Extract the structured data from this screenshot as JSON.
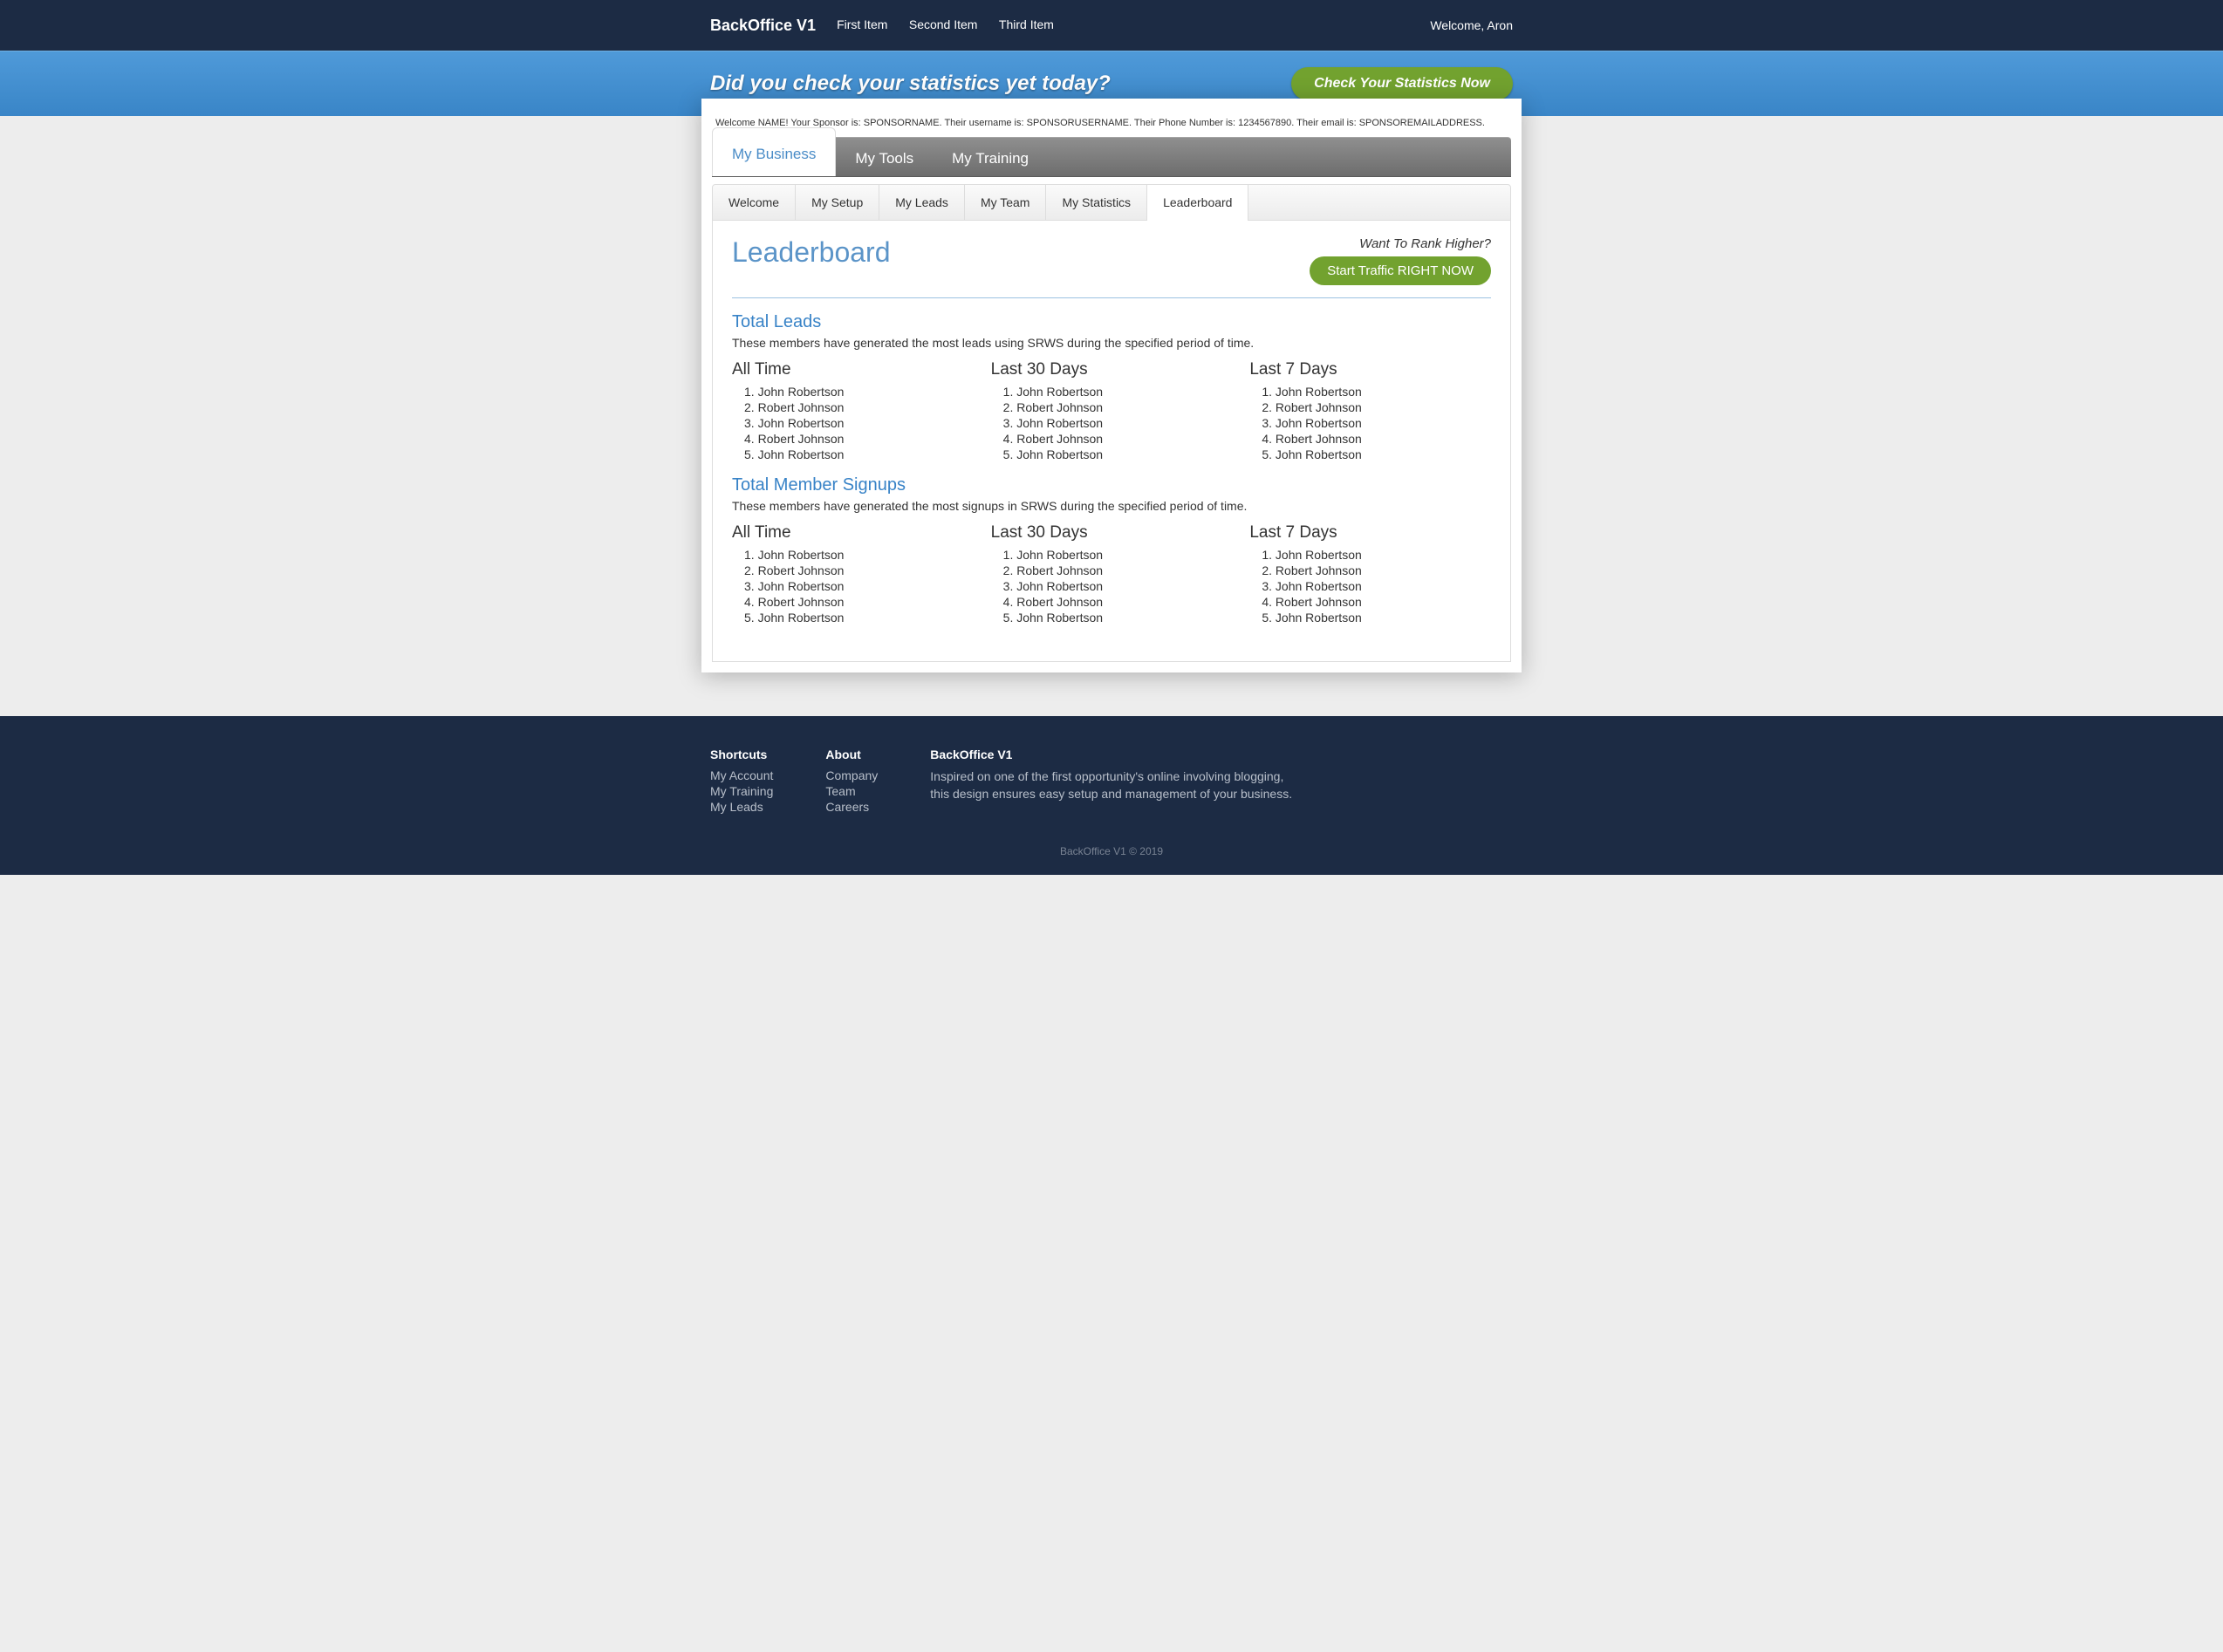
{
  "header": {
    "brand": "BackOffice V1",
    "nav": [
      "First Item",
      "Second Item",
      "Third Item"
    ],
    "welcome": "Welcome, Aron"
  },
  "hero": {
    "title": "Did you check your statistics yet today?",
    "cta": "Check Your Statistics Now"
  },
  "sponsor_line": "Welcome NAME! Your Sponsor is: SPONSORNAME. Their username is: SPONSORUSERNAME. Their Phone Number is: 1234567890. Their email is: SPONSOREMAILADDRESS.",
  "main_tabs": [
    {
      "label": "My Business",
      "active": true
    },
    {
      "label": "My Tools",
      "active": false
    },
    {
      "label": "My Training",
      "active": false
    }
  ],
  "sub_tabs": [
    {
      "label": "Welcome",
      "active": false
    },
    {
      "label": "My Setup",
      "active": false
    },
    {
      "label": "My Leads",
      "active": false
    },
    {
      "label": "My Team",
      "active": false
    },
    {
      "label": "My Statistics",
      "active": false
    },
    {
      "label": "Leaderboard",
      "active": true
    }
  ],
  "page": {
    "title": "Leaderboard",
    "rank_question": "Want To Rank Higher?",
    "rank_cta": "Start Traffic RIGHT NOW"
  },
  "sections": [
    {
      "title": "Total Leads",
      "desc": "These members have generated the most leads using SRWS during the specified period of time.",
      "columns": [
        {
          "heading": "All Time",
          "items": [
            "John Robertson",
            "Robert Johnson",
            "John Robertson",
            "Robert Johnson",
            "John Robertson"
          ]
        },
        {
          "heading": "Last 30 Days",
          "items": [
            "John Robertson",
            "Robert Johnson",
            "John Robertson",
            "Robert Johnson",
            "John Robertson"
          ]
        },
        {
          "heading": "Last 7 Days",
          "items": [
            "John Robertson",
            "Robert Johnson",
            "John Robertson",
            "Robert Johnson",
            "John Robertson"
          ]
        }
      ]
    },
    {
      "title": "Total Member Signups",
      "desc": "These members have generated the most signups in SRWS during the specified period of time.",
      "columns": [
        {
          "heading": "All Time",
          "items": [
            "John Robertson",
            "Robert Johnson",
            "John Robertson",
            "Robert Johnson",
            "John Robertson"
          ]
        },
        {
          "heading": "Last 30 Days",
          "items": [
            "John Robertson",
            "Robert Johnson",
            "John Robertson",
            "Robert Johnson",
            "John Robertson"
          ]
        },
        {
          "heading": "Last 7 Days",
          "items": [
            "John Robertson",
            "Robert Johnson",
            "John Robertson",
            "Robert Johnson",
            "John Robertson"
          ]
        }
      ]
    }
  ],
  "footer": {
    "shortcuts_title": "Shortcuts",
    "shortcuts": [
      "My Account",
      "My Training",
      "My Leads"
    ],
    "about_title": "About",
    "about_links": [
      "Company",
      "Team",
      "Careers"
    ],
    "brand_title": "BackOffice V1",
    "brand_desc": "Inspired on one of the first opportunity's online involving blogging, this design ensures easy setup and management of your business.",
    "copyright": "BackOffice V1 © 2019"
  }
}
